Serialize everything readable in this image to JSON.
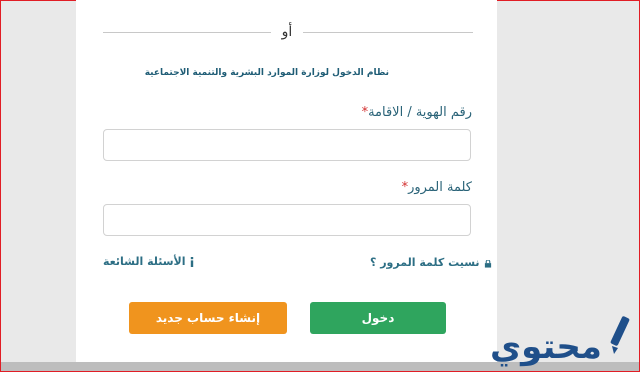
{
  "divider": {
    "or_text": "أو"
  },
  "subtitle": "نظام الدخول لوزارة الموارد البشرية والتنمية الاجتماعية",
  "form": {
    "id_label": "رقم الهوية / الاقامة",
    "id_value": "",
    "password_label": "كلمة المرور",
    "password_value": "",
    "required_mark": "*"
  },
  "links": {
    "forgot_password": "نسيت كلمة المرور ؟",
    "faq": "الأسئلة الشائعة"
  },
  "buttons": {
    "login": "دخول",
    "create_account": "إنشاء حساب جديد"
  },
  "watermark": {
    "text": "محتوي"
  },
  "colors": {
    "login_button": "#2fa55e",
    "register_button": "#f0941e",
    "link": "#2c6e84",
    "label": "#2a6378",
    "required": "#d32f2f",
    "border": "#e11d25",
    "watermark": "#1f4f8a"
  }
}
